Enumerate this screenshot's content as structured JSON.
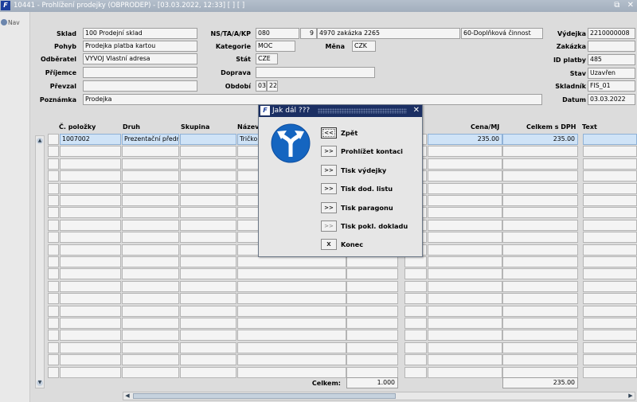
{
  "window": {
    "title": "10441 - Prohlížení prodejky (OBPRODEP) - [03.03.2022, 12:33] [ ] [ ]",
    "controls": [
      "⧉",
      "✕"
    ]
  },
  "left_pane": {
    "nav_label": "Nav"
  },
  "header": {
    "sklad_label": "Sklad",
    "sklad_value": "100 Prodejní sklad",
    "pohyb_label": "Pohyb",
    "pohyb_value": "Prodejka platba kartou",
    "odberatel_label": "Odběratel",
    "odberatel_value": "VYVOJ Vlastní adresa",
    "prijemce_label": "Příjemce",
    "prijemce_value": "",
    "prevzal_label": "Převzal",
    "prevzal_value": "",
    "poznamka_label": "Poznámka",
    "poznamka_value": "Prodejka",
    "ns_label": "NS/TA/A/KP",
    "ns_value": "080",
    "ta_value": "9",
    "a_value": "4970 zakázka 2265",
    "kp_value": "60-Doplňková činnost",
    "kategorie_label": "Kategorie",
    "kategorie_value": "MOC",
    "mena_label": "Měna",
    "mena_value": "CZK",
    "stat_label": "Stát",
    "stat_value": "CZE",
    "doprava_label": "Doprava",
    "doprava_value": "",
    "obdobi_label": "Období",
    "obdobi_month": "03",
    "obdobi_year": "22",
    "vydejka_label": "Výdejka",
    "vydejka_value": "2210000008",
    "zakazka_label": "Zakázka",
    "zakazka_value": "",
    "id_platby_label": "ID platby",
    "id_platby_value": "485",
    "stav_label": "Stav",
    "stav_value": "Uzavřen",
    "skladnik_label": "Skladník",
    "skladnik_value": "FIS_01",
    "datum_label": "Datum",
    "datum_value": "03.03.2022"
  },
  "table": {
    "columns": {
      "c_polozky": "Č. položky",
      "druh": "Druh",
      "skupina": "Skupina",
      "nazev": "Název",
      "cena_mj": "Cena/MJ",
      "celkem_dph": "Celkem s DPH",
      "text": "Text"
    },
    "rows": [
      {
        "c_polozky": "1007002",
        "druh": "Prezentační předm",
        "skupina": "",
        "nazev": "Tričko",
        "cena_mj": "235.00",
        "celkem_dph": "235.00",
        "text": ""
      }
    ],
    "footer": {
      "celkem_label": "Celkem:",
      "celkem_qty": "1.000",
      "celkem_total": "235.00"
    }
  },
  "dialog": {
    "title": "Jak dál ???",
    "close": "✕",
    "buttons": [
      {
        "symbol": "<<",
        "label": "Zpět",
        "enabled": true
      },
      {
        "symbol": ">>",
        "label": "Prohlížet kontaci",
        "enabled": true
      },
      {
        "symbol": ">>",
        "label": "Tisk výdejky",
        "enabled": true
      },
      {
        "symbol": ">>",
        "label": "Tisk dod. listu",
        "enabled": true
      },
      {
        "symbol": ">>",
        "label": "Tisk paragonu",
        "enabled": true
      },
      {
        "symbol": ">>",
        "label": "Tisk pokl. dokladu",
        "enabled": false
      },
      {
        "symbol": "X",
        "label": "Konec",
        "enabled": true
      }
    ]
  },
  "colors": {
    "titlebar": "#a8b4c3",
    "dialog_title": "#1b2f63",
    "sign_blue": "#1565c0",
    "selected_row": "#cfe3f7"
  }
}
